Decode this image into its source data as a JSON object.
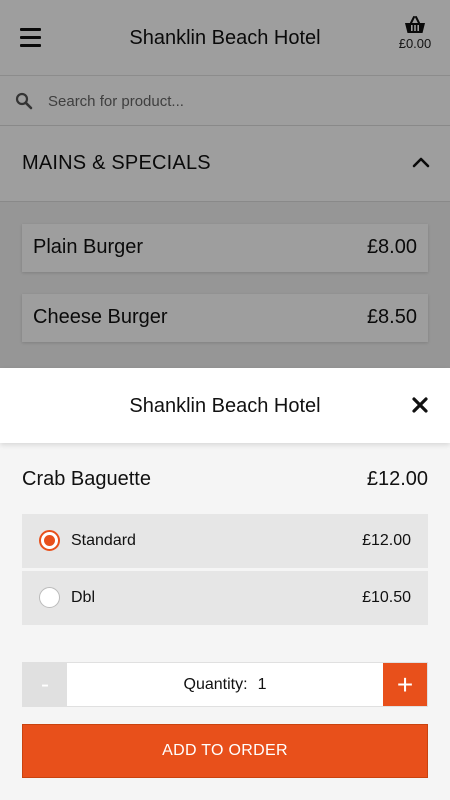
{
  "header": {
    "title": "Shanklin Beach Hotel",
    "cart_total": "£0.00",
    "icons": {
      "menu": "hamburger-menu-icon",
      "cart": "shopping-basket-icon"
    }
  },
  "search": {
    "placeholder": "Search for product...",
    "value": "",
    "icon": "search-icon"
  },
  "category": {
    "label": "MAINS & SPECIALS",
    "expanded": true,
    "icon": "chevron-up-icon"
  },
  "products": [
    {
      "name": "Plain Burger",
      "price": "£8.00"
    },
    {
      "name": "Cheese Burger",
      "price": "£8.50"
    }
  ],
  "modal": {
    "title": "Shanklin Beach Hotel",
    "close_icon": "close-icon",
    "item": {
      "name": "Crab Baguette",
      "price": "£12.00"
    },
    "options": [
      {
        "label": "Standard",
        "price": "£12.00",
        "selected": true
      },
      {
        "label": "Dbl",
        "price": "£10.50",
        "selected": false
      }
    ],
    "quantity": {
      "label": "Quantity:",
      "value": "1",
      "minus": "-",
      "plus": "+"
    },
    "add_button": "ADD TO ORDER"
  },
  "colors": {
    "accent": "#e8501b",
    "overlay": "rgba(0,0,0,0.38)",
    "option_bg": "#e6e6e6"
  }
}
